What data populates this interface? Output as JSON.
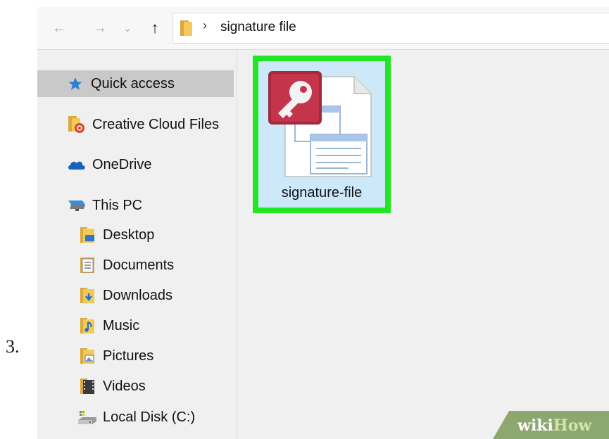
{
  "step": {
    "number": "3."
  },
  "toolbar": {
    "back_glyph": "←",
    "forward_glyph": "→",
    "recent_glyph": "⌄",
    "up_glyph": "↑",
    "path_separator": "›",
    "path_crumb": "signature file"
  },
  "sidebar": {
    "items": [
      {
        "label": "Quick access",
        "icon": "star-icon",
        "selected": true
      },
      {
        "label": "Creative Cloud Files",
        "icon": "creative-cloud-folder-icon"
      },
      {
        "label": "OneDrive",
        "icon": "cloud-icon"
      },
      {
        "label": "This PC",
        "icon": "computer-icon"
      },
      {
        "label": "Desktop",
        "icon": "desktop-folder-icon"
      },
      {
        "label": "Documents",
        "icon": "documents-folder-icon"
      },
      {
        "label": "Downloads",
        "icon": "downloads-folder-icon"
      },
      {
        "label": "Music",
        "icon": "music-folder-icon"
      },
      {
        "label": "Pictures",
        "icon": "pictures-folder-icon"
      },
      {
        "label": "Videos",
        "icon": "videos-folder-icon"
      },
      {
        "label": "Local Disk (C:)",
        "icon": "local-disk-icon"
      }
    ]
  },
  "content": {
    "file": {
      "name": "signature-file",
      "icon": "access-database-icon",
      "highlight_color": "#22e622"
    }
  },
  "watermark": {
    "part1": "wiki",
    "part2": "How"
  },
  "colors": {
    "selection": "#c9c9c9",
    "file_selected_bg": "#cde8f9",
    "folder": "#f3c95a"
  }
}
